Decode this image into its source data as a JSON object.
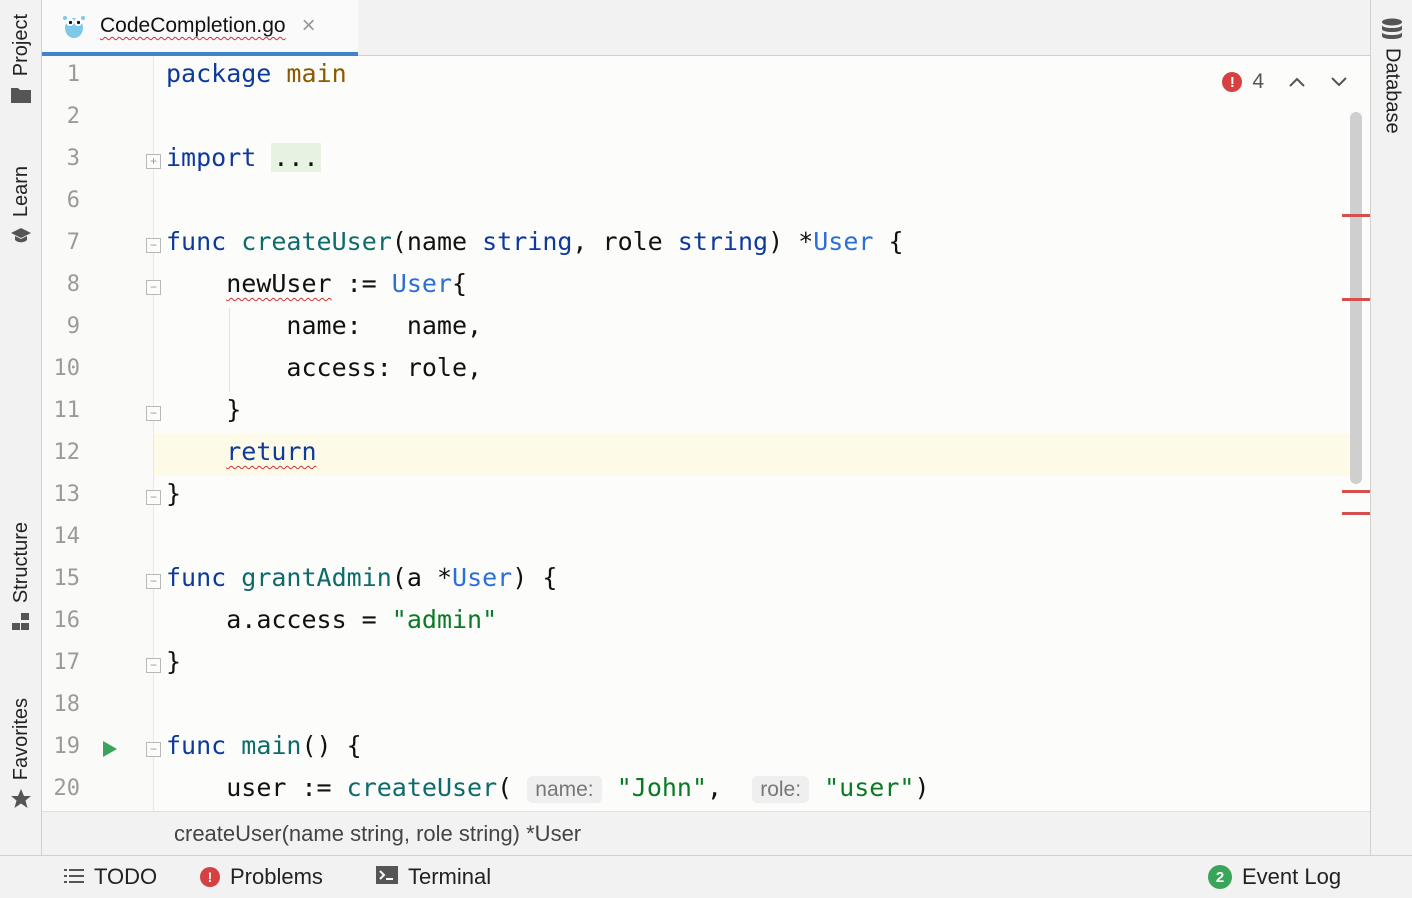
{
  "tab": {
    "filename": "CodeCompletion.go",
    "close_glyph": "×"
  },
  "left_toolbar": [
    {
      "label": "Project",
      "icon": "folder-icon"
    },
    {
      "label": "Learn",
      "icon": "graduation-cap-icon"
    },
    {
      "label": "Structure",
      "icon": "structure-icon"
    },
    {
      "label": "Favorites",
      "icon": "star-icon"
    }
  ],
  "right_toolbar": [
    {
      "label": "Database",
      "icon": "database-icon"
    }
  ],
  "inspection": {
    "error_count": "4",
    "error_color": "#d64040"
  },
  "gutter": {
    "line_numbers": [
      "1",
      "2",
      "3",
      "6",
      "7",
      "8",
      "9",
      "10",
      "11",
      "12",
      "13",
      "14",
      "15",
      "16",
      "17",
      "18",
      "19",
      "20"
    ],
    "current_line": "12"
  },
  "code": {
    "l1_kw": "package",
    "l1_name": "main",
    "l3_kw": "import",
    "l3_fold": "...",
    "l7_kw": "func",
    "l7_fn": "createUser",
    "l7_open": "(name ",
    "l7_t1": "string",
    "l7_mid": ", role ",
    "l7_t2": "string",
    "l7_close": ") *",
    "l7_ret": "User",
    "l7_brace": " {",
    "l8_var": "newUser",
    "l8_op": " := ",
    "l8_ty": "User",
    "l8_brace": "{",
    "l9": "name:   name,",
    "l10": "access: role,",
    "l11": "}",
    "l12_kw": "return",
    "l13": "}",
    "l15_kw": "func",
    "l15_fn": "grantAdmin",
    "l15_open": "(a *",
    "l15_ty": "User",
    "l15_close": ") {",
    "l16_lhs": "a.access = ",
    "l16_str": "\"admin\"",
    "l17": "}",
    "l19_kw": "func",
    "l19_fn": "main",
    "l19_rest": "() {",
    "l20_lhs": "user := ",
    "l20_fn": "createUser",
    "l20_open": "(",
    "l20_hint1": "name:",
    "l20_arg1": "\"John\"",
    "l20_comma": ",",
    "l20_hint2": "role:",
    "l20_arg2": "\"user\"",
    "l20_close": ")"
  },
  "param_hint": "createUser(name string, role string) *User",
  "statusbar": {
    "todo": "TODO",
    "problems": "Problems",
    "terminal": "Terminal",
    "event_log": "Event Log",
    "event_log_count": "2"
  },
  "colors": {
    "accent": "#4083c9",
    "keyword": "#0e3a9c",
    "type": "#2c6fd8",
    "string": "#0a7a25",
    "error": "#d64040",
    "success": "#3aa55a"
  }
}
